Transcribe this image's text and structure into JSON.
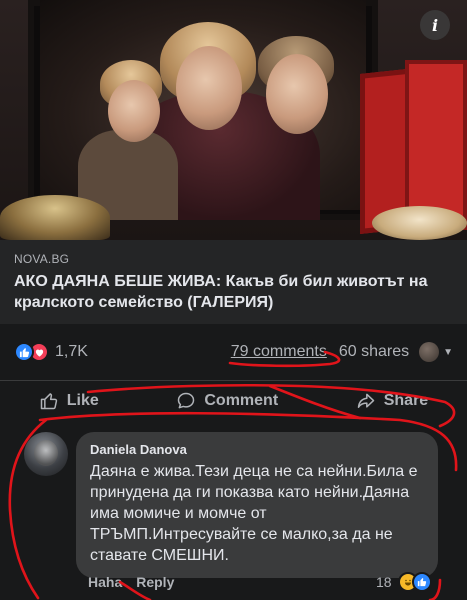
{
  "post": {
    "info_icon": "i",
    "link": {
      "source": "NOVA.BG",
      "title": "АКО ДАЯНА БЕШЕ ЖИВА: Какъв би бил животът на кралското семейство (ГАЛЕРИЯ)"
    },
    "reactions": {
      "icons": [
        "like-icon",
        "love-icon"
      ],
      "count": "1,7K"
    },
    "comments_count": "79 comments",
    "shares_count": "60 shares",
    "actions": {
      "like": "Like",
      "comment": "Comment",
      "share": "Share"
    }
  },
  "comment": {
    "author": "Daniela Danova",
    "text": "Даяна е жива.Тези деца не са нейни.Била е принудена да ги показва като нейни.Даяна има момиче и момче от ТРЪМП.Интресувайте се малко,за да не ставате СМЕШНИ.",
    "reaction_label": "Haha",
    "reply_label": "Reply",
    "reaction_count": "18"
  },
  "colors": {
    "background": "#18191a",
    "card": "#242526",
    "bubble": "#3a3b3c",
    "annotation": "#e0141a",
    "like_blue": "#2d88ff",
    "love_red": "#f33e58",
    "haha_yellow": "#f7b928"
  }
}
